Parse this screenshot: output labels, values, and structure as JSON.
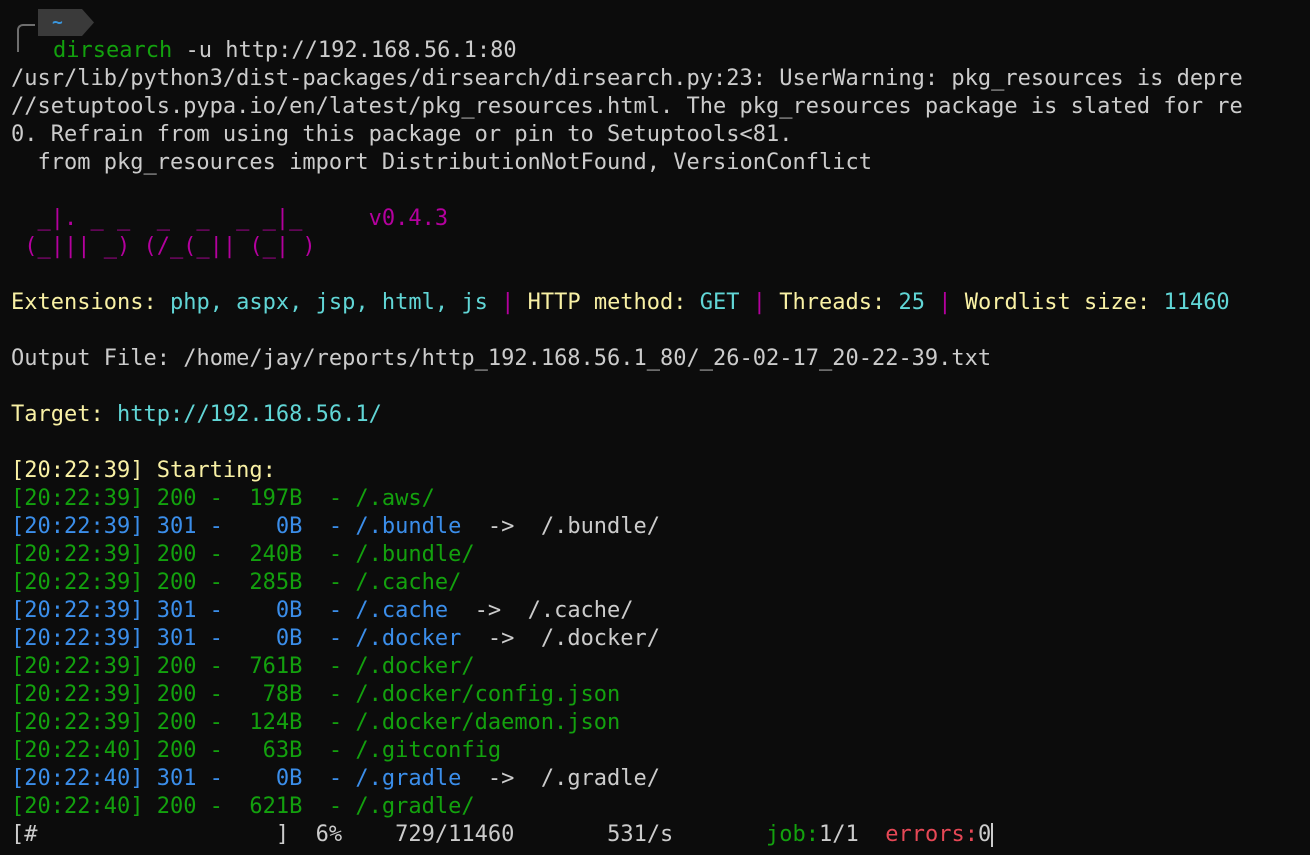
{
  "prompt": {
    "dir": "~",
    "cmd_name": "dirsearch",
    "cmd_args": " -u http://192.168.56.1:80"
  },
  "warning": {
    "line1": "/usr/lib/python3/dist-packages/dirsearch/dirsearch.py:23: UserWarning: pkg_resources is depre",
    "line2": "//setuptools.pypa.io/en/latest/pkg_resources.html. The pkg_resources package is slated for re",
    "line3": "0. Refrain from using this package or pin to Setuptools<81.",
    "line4": "  from pkg_resources import DistributionNotFound, VersionConflict"
  },
  "banner": {
    "row1": "  _|. _ _  _  _  _ _|_",
    "row2": " (_||| _) (/_(_|| (_| )",
    "version": "v0.4.3"
  },
  "config": {
    "ext_label": "Extensions:",
    "ext_value": "php, aspx, jsp, html, js",
    "sep": "|",
    "method_label": "HTTP method:",
    "method_value": "GET",
    "threads_label": "Threads:",
    "threads_value": "25",
    "wordlist_label": "Wordlist size:",
    "wordlist_value": "11460"
  },
  "output": {
    "label": "Output File:",
    "path": "/home/jay/reports/http_192.168.56.1_80/_26-02-17_20-22-39.txt"
  },
  "target": {
    "label": "Target:",
    "url": "http://192.168.56.1/"
  },
  "starting": {
    "time": "[20:22:39]",
    "text": "Starting:"
  },
  "results": [
    {
      "time": "[20:22:39]",
      "code": "200",
      "size": "197B",
      "path": "/.aws/",
      "redirect": "",
      "color": "#13a10e"
    },
    {
      "time": "[20:22:39]",
      "code": "301",
      "size": "0B",
      "path": "/.bundle",
      "redirect": "/.bundle/",
      "color": "#3b8eea"
    },
    {
      "time": "[20:22:39]",
      "code": "200",
      "size": "240B",
      "path": "/.bundle/",
      "redirect": "",
      "color": "#13a10e"
    },
    {
      "time": "[20:22:39]",
      "code": "200",
      "size": "285B",
      "path": "/.cache/",
      "redirect": "",
      "color": "#13a10e"
    },
    {
      "time": "[20:22:39]",
      "code": "301",
      "size": "0B",
      "path": "/.cache",
      "redirect": "/.cache/",
      "color": "#3b8eea"
    },
    {
      "time": "[20:22:39]",
      "code": "301",
      "size": "0B",
      "path": "/.docker",
      "redirect": "/.docker/",
      "color": "#3b8eea"
    },
    {
      "time": "[20:22:39]",
      "code": "200",
      "size": "761B",
      "path": "/.docker/",
      "redirect": "",
      "color": "#13a10e"
    },
    {
      "time": "[20:22:39]",
      "code": "200",
      "size": "78B",
      "path": "/.docker/config.json",
      "redirect": "",
      "color": "#13a10e"
    },
    {
      "time": "[20:22:39]",
      "code": "200",
      "size": "124B",
      "path": "/.docker/daemon.json",
      "redirect": "",
      "color": "#13a10e"
    },
    {
      "time": "[20:22:40]",
      "code": "200",
      "size": "63B",
      "path": "/.gitconfig",
      "redirect": "",
      "color": "#13a10e"
    },
    {
      "time": "[20:22:40]",
      "code": "301",
      "size": "0B",
      "path": "/.gradle",
      "redirect": "/.gradle/",
      "color": "#3b8eea"
    },
    {
      "time": "[20:22:40]",
      "code": "200",
      "size": "621B",
      "path": "/.gradle/",
      "redirect": "",
      "color": "#13a10e"
    }
  ],
  "progress": {
    "bar": "[#                  ]",
    "percent": "6%",
    "count": "729/11460",
    "rate": "531/s",
    "job_label": "job:",
    "job_value": "1/1",
    "errors_label": "errors:",
    "errors_value": "0"
  }
}
